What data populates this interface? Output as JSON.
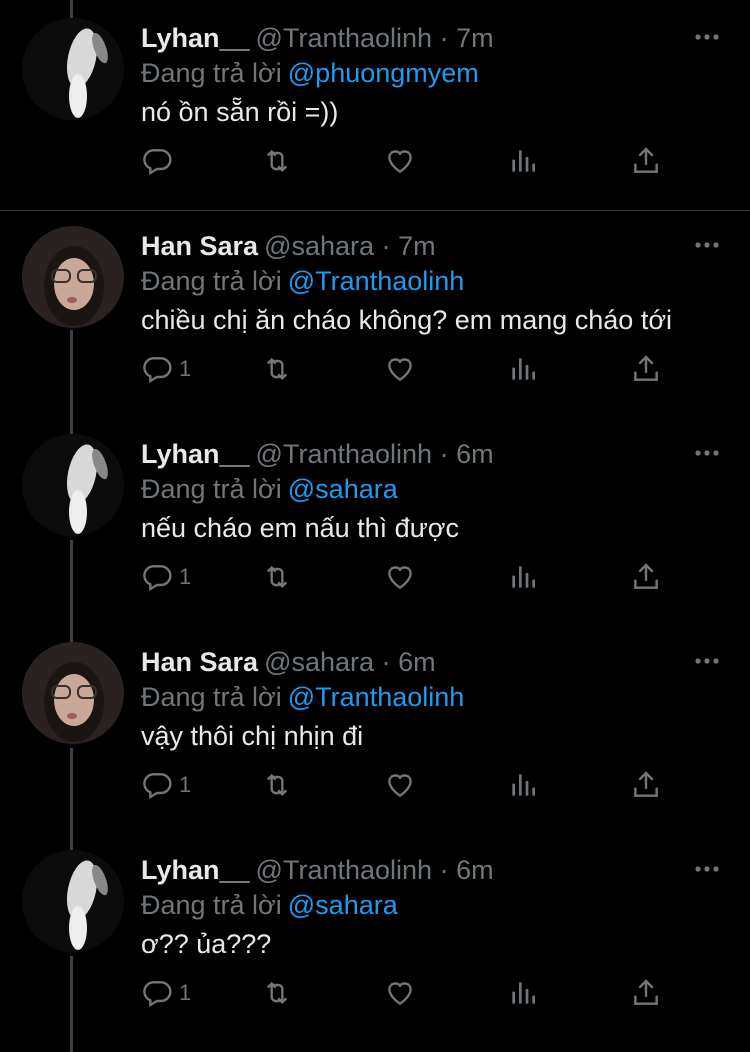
{
  "reply_prefix": "Đang trả lời",
  "tweets": [
    {
      "name": "Lyhan__",
      "handle": "@Tranthaolinh",
      "dot": "·",
      "time": "7m",
      "mention": "@phuongmyem",
      "text": "nó ồn sẵn rồi =))",
      "replies": "",
      "avatar": "lyhan-avatar"
    },
    {
      "name": "Han Sara",
      "handle": "@sahara",
      "dot": "·",
      "time": "7m",
      "mention": "@Tranthaolinh",
      "text": "chiều chị ăn cháo không? em mang cháo tới",
      "replies": "1",
      "avatar": "sara-avatar"
    },
    {
      "name": "Lyhan__",
      "handle": "@Tranthaolinh",
      "dot": "·",
      "time": "6m",
      "mention": "@sahara",
      "text": "nếu cháo em nấu thì được",
      "replies": "1",
      "avatar": "lyhan-avatar"
    },
    {
      "name": "Han Sara",
      "handle": "@sahara",
      "dot": "·",
      "time": "6m",
      "mention": "@Tranthaolinh",
      "text": "vậy thôi chị nhịn đi",
      "replies": "1",
      "avatar": "sara-avatar"
    },
    {
      "name": "Lyhan__",
      "handle": "@Tranthaolinh",
      "dot": "·",
      "time": "6m",
      "mention": "@sahara",
      "text": "ơ?? ủa???",
      "replies": "1",
      "avatar": "lyhan-avatar"
    }
  ],
  "icons": {
    "reply": "reply-icon",
    "retweet": "retweet-icon",
    "like": "heart-icon",
    "views": "analytics-icon",
    "share": "share-icon",
    "more": "more-icon"
  },
  "colors": {
    "background": "#000000",
    "text": "#e7e9ea",
    "secondary": "#71767b",
    "mention": "#1d9bf0",
    "divider": "#2f3336"
  }
}
